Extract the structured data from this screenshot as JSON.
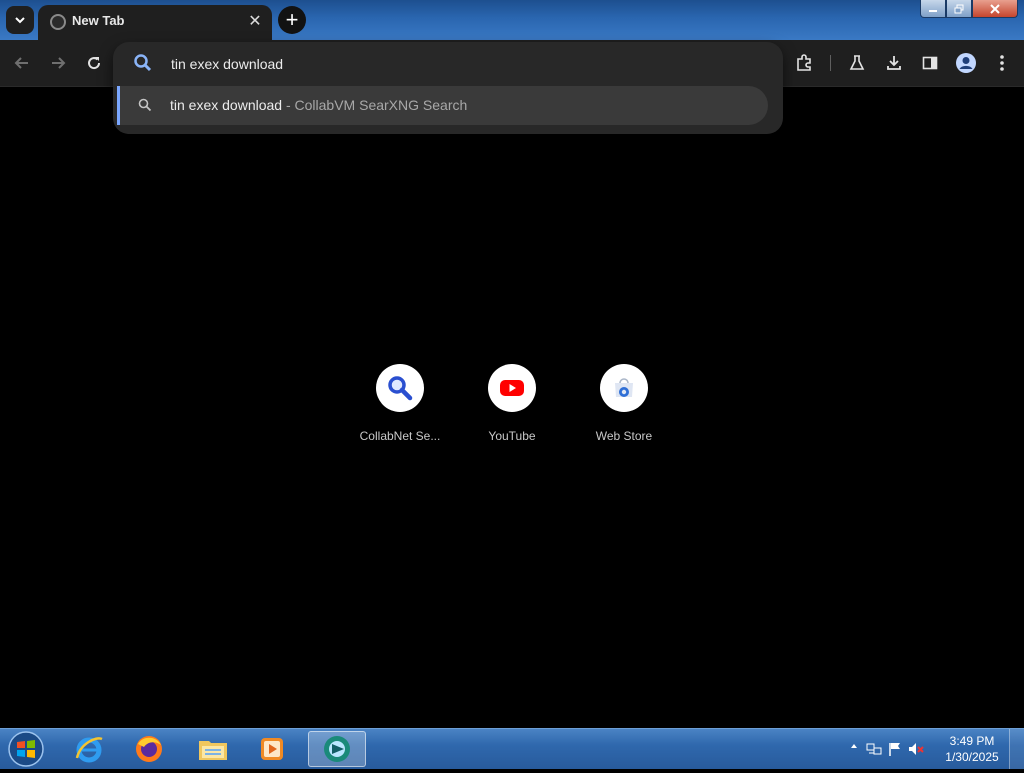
{
  "tab": {
    "title": "New Tab",
    "close_glyph": "✕"
  },
  "new_tab_glyph": "+",
  "window_controls": {
    "minimize": "—",
    "maximize": "❐",
    "close": "✕"
  },
  "omnibox": {
    "value": "tin exex download",
    "suggestion": {
      "query": "tin exex download",
      "separator": " - ",
      "engine": "CollabVM SearXNG Search"
    }
  },
  "shortcuts": [
    {
      "label": "CollabNet Se...",
      "icon": "magnifier-icon"
    },
    {
      "label": "YouTube",
      "icon": "youtube-icon"
    },
    {
      "label": "Web Store",
      "icon": "web-store-icon"
    }
  ],
  "taskbar": {
    "apps": [
      "internet-explorer-icon",
      "firefox-icon",
      "file-explorer-icon",
      "media-player-icon",
      "chrome-icon"
    ],
    "clock": {
      "time": "3:49 PM",
      "date": "1/30/2025"
    }
  },
  "colors": {
    "accent": "#7aa7ff",
    "toolbar": "#1f1f1f",
    "omnibox": "#282828",
    "youtube_red": "#ff0000"
  }
}
